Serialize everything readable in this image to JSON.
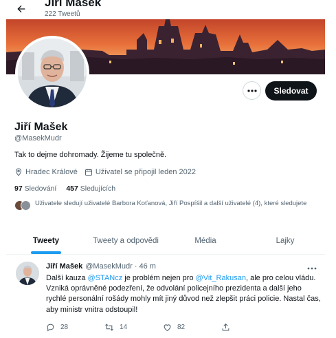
{
  "header": {
    "back_icon": "arrow-left-icon",
    "title": "Jiří Mašek",
    "tweet_count": "222 Tweetů"
  },
  "profile": {
    "name": "Jiří Mašek",
    "handle": "@MasekMudr",
    "bio": "Tak to dejme dohromady. Žijeme tu společně.",
    "location": "Hradec Králové",
    "joined": "Uživatel se připojil leden 2022",
    "following_count": "97",
    "following_label": "Sledování",
    "followers_count": "457",
    "followers_label": "Sledujících",
    "followed_by": "Uživatele sledují uživatelé Barbora Koťanová, Jiří Pospíšil a další uživatelé (4), které sledujete"
  },
  "actions": {
    "follow_label": "Sledovat",
    "more_icon": "more-horizontal-icon"
  },
  "tabs": [
    {
      "label": "Tweety",
      "active": true
    },
    {
      "label": "Tweety a odpovědi",
      "active": false
    },
    {
      "label": "Média",
      "active": false
    },
    {
      "label": "Lajky",
      "active": false
    }
  ],
  "tweet": {
    "author": "Jiří Mašek",
    "handle": "@MasekMudr",
    "separator": "·",
    "time": "46 m",
    "text_1": "Další kauza ",
    "mention_1": "@STANcz",
    "text_2": " je problém nejen pro ",
    "mention_2": "@Vit_Rakusan",
    "text_3": ", ale pro celou vládu. Vzniká oprávněné podezření, že odvolání policejního prezidenta a další jeho rychlé personální rošády mohly mít jiný důvod než zlepšit práci policie. Nastal čas, aby ministr vnitra odstoupil!",
    "replies": "28",
    "retweets": "14",
    "likes": "82"
  },
  "colors": {
    "accent": "#1d9bf0",
    "text": "#0f1419",
    "muted": "#536471",
    "follow_button": "#0f1419"
  }
}
